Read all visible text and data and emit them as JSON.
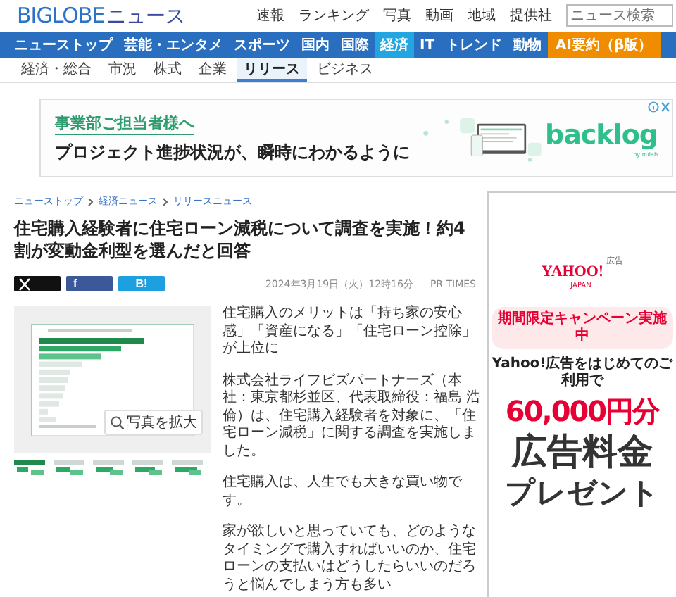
{
  "header": {
    "brand": "BIGLOBE",
    "service": "ニュース",
    "links": [
      "速報",
      "ランキング",
      "写真",
      "動画",
      "地域",
      "提供社"
    ],
    "search": {
      "placeholder": "ニュース検索"
    }
  },
  "nav": [
    {
      "label": "ニューストップ",
      "kind": "section",
      "selected": false
    },
    {
      "label": "芸能・エンタメ",
      "kind": "section",
      "selected": false
    },
    {
      "label": "スポーツ",
      "kind": "section",
      "selected": false
    },
    {
      "label": "国内",
      "kind": "section",
      "selected": false
    },
    {
      "label": "国際",
      "kind": "section",
      "selected": false
    },
    {
      "label": "経済",
      "kind": "section",
      "selected": true
    },
    {
      "label": "IT",
      "kind": "section",
      "selected": false
    },
    {
      "label": "トレンド",
      "kind": "section",
      "selected": false
    },
    {
      "label": "動物",
      "kind": "section",
      "selected": false
    },
    {
      "label": "AI要約（β版）",
      "kind": "feature",
      "selected": false
    }
  ],
  "subnav": [
    {
      "label": "経済・総合",
      "selected": false
    },
    {
      "label": "市況",
      "selected": false
    },
    {
      "label": "株式",
      "selected": false
    },
    {
      "label": "企業",
      "selected": false
    },
    {
      "label": "リリース",
      "selected": true
    },
    {
      "label": "ビジネス",
      "selected": false
    }
  ],
  "banner_ad": {
    "headline": "事業部ご担当者様へ",
    "tagline": "プロジェクト進捗状況が、瞬時にわかるように",
    "brand": "backlog",
    "brand_sub": "by nulab"
  },
  "breadcrumb": [
    "ニューストップ",
    "経済ニュース",
    "リリースニュース"
  ],
  "article": {
    "title": "住宅購入経験者に住宅ローン減税について調査を実施！約4割が変動金利型を選んだと回答",
    "share": [
      {
        "kind": "x"
      },
      {
        "kind": "facebook",
        "label": "f"
      },
      {
        "kind": "hatena",
        "label": "B!"
      }
    ],
    "date": "2024年3月19日（火）12時16分",
    "source": "PR TIMES",
    "photo": {
      "kind": "picture",
      "enlarge": "写真を拡大"
    },
    "paragraphs": [
      {
        "kind": "lead",
        "text": "住宅購入のメリットは「持ち家の安心感」「資産になる」「住宅ローン控除」が上位に"
      },
      {
        "kind": "body",
        "text": "株式会社ライフビズパートナーズ（本社：東京都杉並区、代表取締役：福島 浩倫）は、住宅購入経験者を対象に、「住宅ローン減税」に関する調査を実施しました。"
      },
      {
        "kind": "body",
        "text": "住宅購入は、人生でも大きな買い物です。"
      },
      {
        "kind": "body",
        "text": "家が欲しいと思っていても、どのようなタイミングで購入すればいいのか、住宅ローンの支払いはどうしたらいいのだろうと悩んでしまう方も多い"
      }
    ]
  },
  "side_ad": {
    "logo": "YAHOO!",
    "logo_sub": "JAPAN",
    "logo_tag": "広告",
    "pill": "期間限定キャンペーン実施中",
    "lead": "Yahoo!広告をはじめてのご利用で",
    "amount": "60,000円分",
    "line1": "広告料金",
    "line2": "プレゼント"
  }
}
